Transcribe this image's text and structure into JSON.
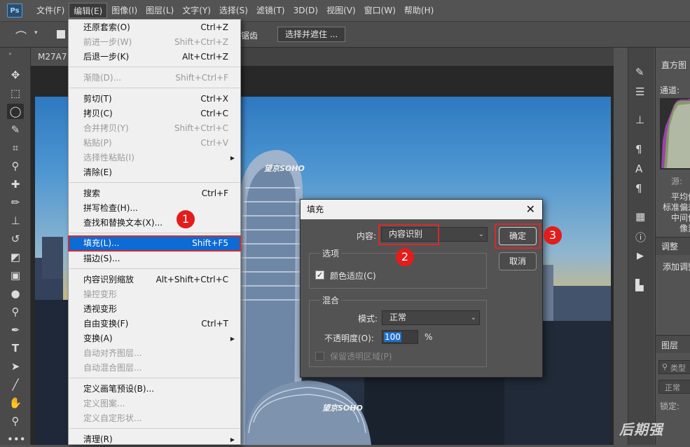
{
  "app": {
    "logo": "Ps"
  },
  "menubar": {
    "items": [
      "文件(F)",
      "编辑(E)",
      "图像(I)",
      "图层(L)",
      "文字(Y)",
      "选择(S)",
      "滤镜(T)",
      "3D(D)",
      "视图(V)",
      "窗口(W)",
      "帮助(H)"
    ]
  },
  "options_bar": {
    "antialias_label": "锯齿",
    "select_mask_button": "选择并遮住 ..."
  },
  "document": {
    "tab_title": "M27A7"
  },
  "edit_menu": {
    "items": [
      {
        "label": "还原套索(O)",
        "shortcut": "Ctrl+Z",
        "disabled": false
      },
      {
        "label": "前进一步(W)",
        "shortcut": "Shift+Ctrl+Z",
        "disabled": true
      },
      {
        "label": "后退一步(K)",
        "shortcut": "Alt+Ctrl+Z",
        "disabled": false
      },
      {
        "label": "渐隐(D)...",
        "shortcut": "Shift+Ctrl+F",
        "disabled": true
      },
      {
        "label": "剪切(T)",
        "shortcut": "Ctrl+X",
        "disabled": false
      },
      {
        "label": "拷贝(C)",
        "shortcut": "Ctrl+C",
        "disabled": false
      },
      {
        "label": "合并拷贝(Y)",
        "shortcut": "Shift+Ctrl+C",
        "disabled": true
      },
      {
        "label": "粘贴(P)",
        "shortcut": "Ctrl+V",
        "disabled": true
      },
      {
        "label": "选择性粘贴(I)",
        "shortcut": "",
        "disabled": true
      },
      {
        "label": "清除(E)",
        "shortcut": "",
        "disabled": false
      },
      {
        "label": "搜索",
        "shortcut": "Ctrl+F",
        "disabled": false
      },
      {
        "label": "拼写检查(H)...",
        "shortcut": "",
        "disabled": false
      },
      {
        "label": "查找和替换文本(X)...",
        "shortcut": "",
        "disabled": false
      },
      {
        "label": "填充(L)...",
        "shortcut": "Shift+F5",
        "disabled": false
      },
      {
        "label": "描边(S)...",
        "shortcut": "",
        "disabled": false
      },
      {
        "label": "内容识别缩放",
        "shortcut": "Alt+Shift+Ctrl+C",
        "disabled": false
      },
      {
        "label": "操控变形",
        "shortcut": "",
        "disabled": true
      },
      {
        "label": "透视变形",
        "shortcut": "",
        "disabled": false
      },
      {
        "label": "自由变换(F)",
        "shortcut": "Ctrl+T",
        "disabled": false
      },
      {
        "label": "变换(A)",
        "shortcut": "",
        "disabled": false
      },
      {
        "label": "自动对齐图层...",
        "shortcut": "",
        "disabled": true
      },
      {
        "label": "自动混合图层...",
        "shortcut": "",
        "disabled": true
      },
      {
        "label": "定义画笔预设(B)...",
        "shortcut": "",
        "disabled": false
      },
      {
        "label": "定义图案...",
        "shortcut": "",
        "disabled": true
      },
      {
        "label": "定义自定形状...",
        "shortcut": "",
        "disabled": true
      },
      {
        "label": "清理(R)",
        "shortcut": "",
        "disabled": false
      }
    ]
  },
  "badges": [
    "1",
    "2",
    "3"
  ],
  "fill_dialog": {
    "title": "填充",
    "content_label": "内容:",
    "content_value": "内容识别",
    "options_group": "选项",
    "color_adapt_label": "颜色适应(C)",
    "color_adapt_checked": true,
    "blend_group": "混合",
    "mode_label": "模式:",
    "mode_value": "正常",
    "opacity_label": "不透明度(O):",
    "opacity_value": "100",
    "opacity_unit": "%",
    "preserve_label": "保留透明区域(P)",
    "ok_button": "确定",
    "cancel_button": "取消"
  },
  "right_panel": {
    "histogram_tab": "直方图",
    "channel_label": "通道:",
    "source_label": "源:",
    "stats": [
      "平均值",
      "标准偏差",
      "中间值",
      "像素"
    ],
    "adjust_tab": "调整",
    "add_adjust": "添加调整",
    "layers_tab": "图层",
    "kind_label": "类型",
    "blend_mode": "正常",
    "lock_label": "锁定:"
  },
  "building_sign": "望京SOHO",
  "watermark": "后期强",
  "colors": {
    "menu_highlight": "#0c6bd4",
    "annotation_red": "#e31c1c"
  }
}
